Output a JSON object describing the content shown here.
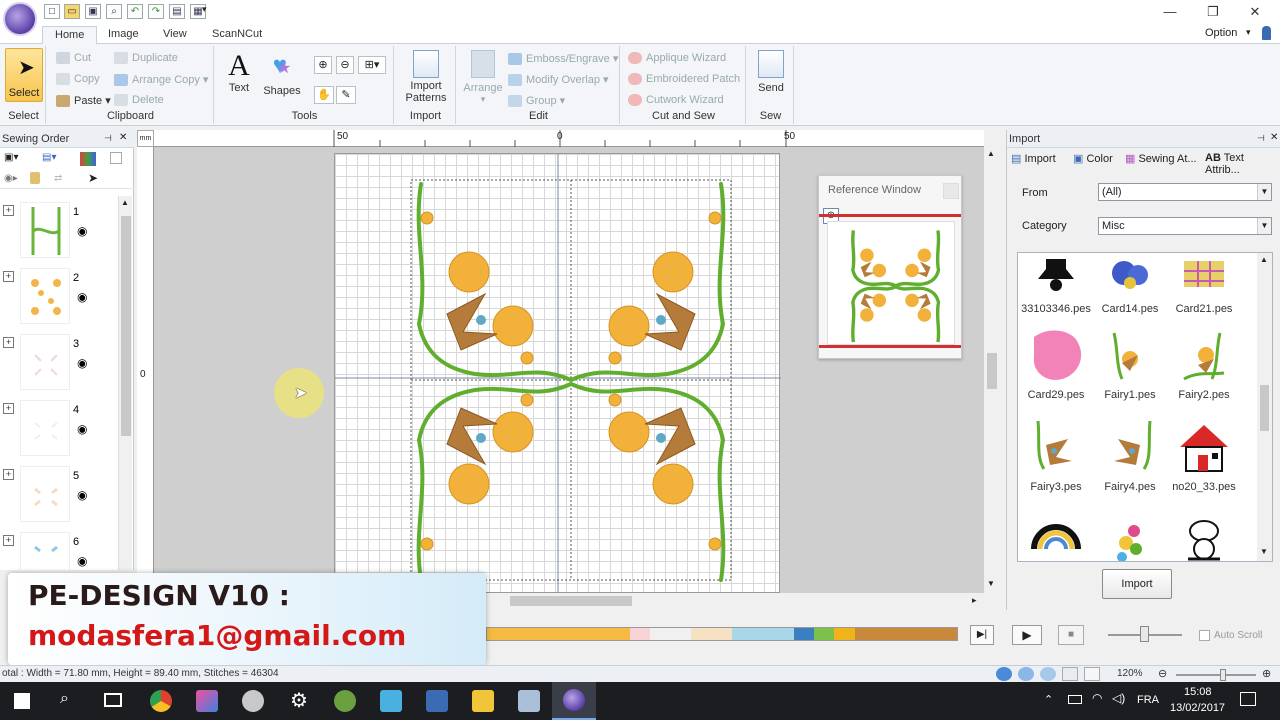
{
  "tabs": [
    "Home",
    "Image",
    "View",
    "ScanNCut"
  ],
  "option_label": "Option",
  "ribbon": {
    "select": {
      "label": "Select",
      "group": "Select"
    },
    "clipboard": {
      "group": "Clipboard",
      "cut": "Cut",
      "copy": "Copy",
      "paste": "Paste",
      "duplicate": "Duplicate",
      "arrange_copy": "Arrange Copy",
      "delete": "Delete"
    },
    "tools": {
      "group": "Tools",
      "text": "Text",
      "shapes": "Shapes"
    },
    "import": {
      "group": "Import",
      "label": "Import Patterns"
    },
    "edit": {
      "group": "Edit",
      "arrange": "Arrange",
      "emboss": "Emboss/Engrave",
      "modify_overlap": "Modify Overlap",
      "group_btn": "Group"
    },
    "cut_sew": {
      "group": "Cut and Sew",
      "applique": "Applique Wizard",
      "embroidered_patch": "Embroidered Patch",
      "cutwork": "Cutwork Wizard"
    },
    "sew": {
      "group": "Sew",
      "label": "Send"
    }
  },
  "sewing_order": {
    "title": "Sewing Order",
    "items": [
      "1",
      "2",
      "3",
      "4",
      "5",
      "6"
    ]
  },
  "ruler": {
    "left": "50",
    "center": "0",
    "right": "50",
    "side": "0"
  },
  "reference_window": {
    "title": "Reference Window"
  },
  "import_panel": {
    "title": "Import",
    "tabs": [
      "Import",
      "Color",
      "Sewing At...",
      "Text Attrib..."
    ],
    "tab_prefix_ab": "AB",
    "from_label": "From",
    "from_value": "(All)",
    "category_label": "Category",
    "category_value": "Misc",
    "files": [
      "33103346.pes",
      "Card14.pes",
      "Card21.pes",
      "Card29.pes",
      "Fairy1.pes",
      "Fairy2.pes",
      "Fairy3.pes",
      "Fairy4.pes",
      "no20_33.pes"
    ],
    "import_button": "Import"
  },
  "playback": {
    "auto_scroll": "Auto Scroll"
  },
  "thread_colors": [
    "#f6b942",
    "#f6b942",
    "#f8d3d8",
    "#f0f0f0",
    "#f6e2c2",
    "#a8d8e8",
    "#3a7fc0",
    "#7cc24a",
    "#f0b31c",
    "#c88a3a"
  ],
  "status": {
    "text": "otal : Width = 71.80 mm, Height = 89.40 mm, Stitches = 46304",
    "zoom": "120%"
  },
  "overlay": {
    "line1": "PE-DESIGN V10 :",
    "line2": "modasfera1@gmail.com"
  },
  "taskbar": {
    "lang": "FRA",
    "time": "15:08",
    "date": "13/02/2017"
  }
}
